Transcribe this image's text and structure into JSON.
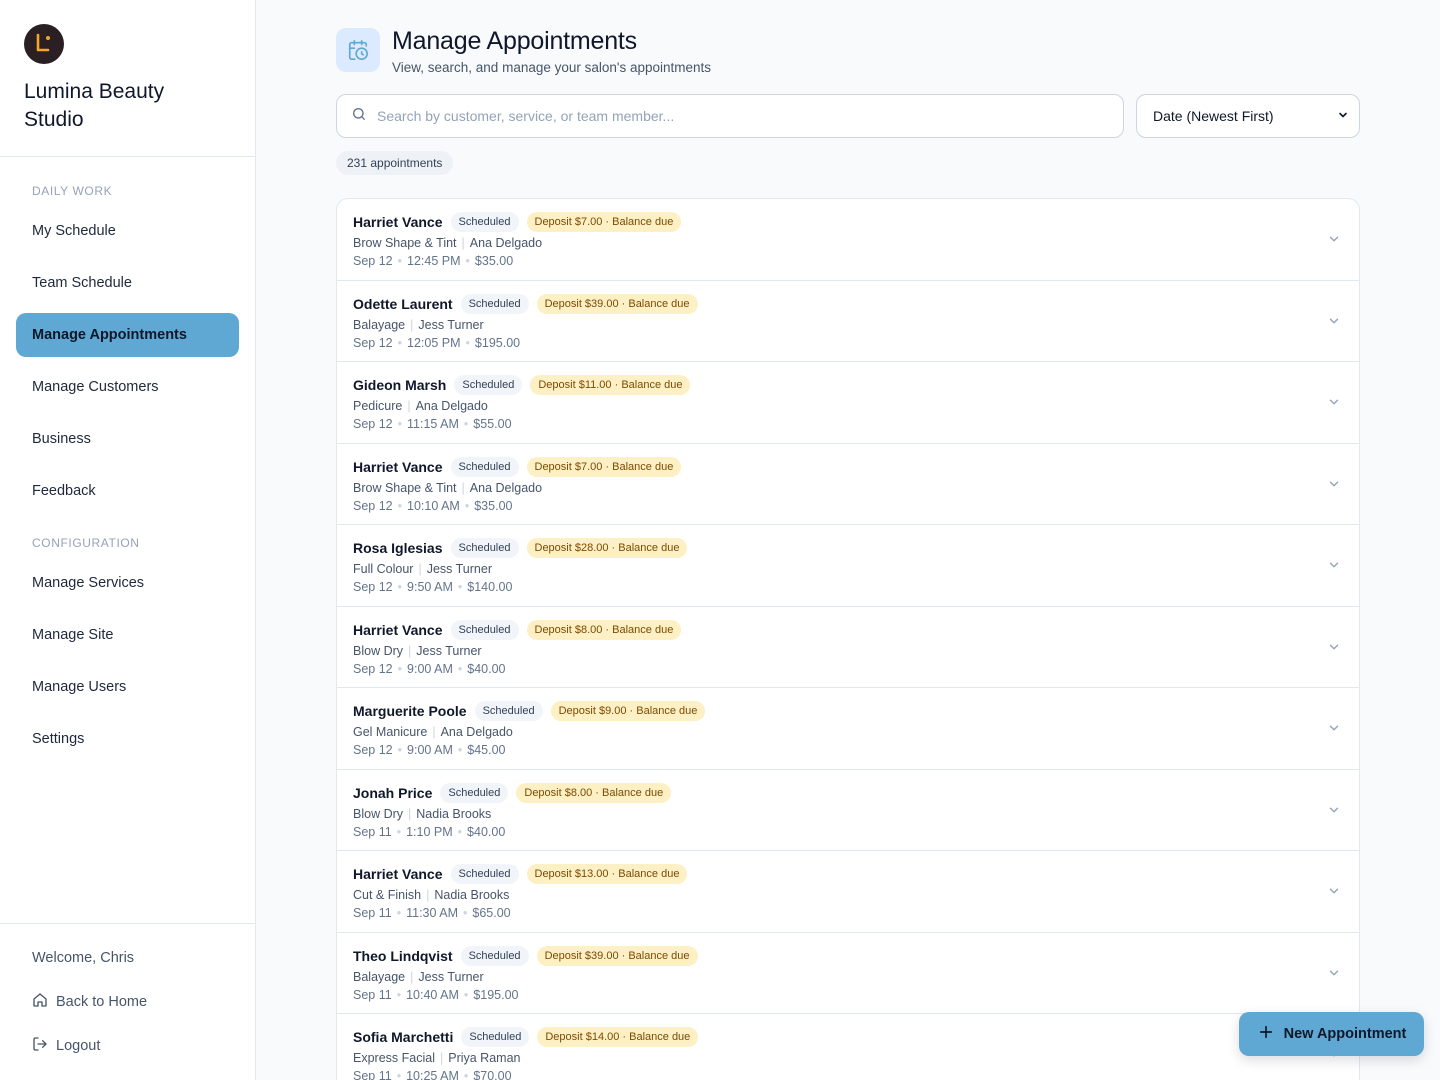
{
  "brand": {
    "name": "Lumina Beauty Studio",
    "logo_letter": "L"
  },
  "sidebar": {
    "sections": [
      {
        "label": "DAILY WORK",
        "items": [
          {
            "label": "My Schedule",
            "active": false
          },
          {
            "label": "Team Schedule",
            "active": false
          },
          {
            "label": "Manage Appointments",
            "active": true
          },
          {
            "label": "Manage Customers",
            "active": false
          },
          {
            "label": "Business",
            "active": false
          },
          {
            "label": "Feedback",
            "active": false
          }
        ]
      },
      {
        "label": "CONFIGURATION",
        "items": [
          {
            "label": "Manage Services",
            "active": false
          },
          {
            "label": "Manage Site",
            "active": false
          },
          {
            "label": "Manage Users",
            "active": false
          },
          {
            "label": "Settings",
            "active": false
          }
        ]
      }
    ],
    "welcome": "Welcome, Chris",
    "back_home": "Back to Home",
    "logout": "Logout"
  },
  "header": {
    "title": "Manage Appointments",
    "subtitle": "View, search, and manage your salon's appointments",
    "icon": "calendar-clock-icon"
  },
  "search": {
    "placeholder": "Search by customer, service, or team member...",
    "value": ""
  },
  "sort": {
    "selected": "Date (Newest First)"
  },
  "count_label": "231 appointments",
  "appointments": [
    {
      "customer": "Harriet Vance",
      "status": "Scheduled",
      "deposit": "Deposit $7.00 · Balance due",
      "service": "Brow Shape & Tint",
      "staff": "Ana Delgado",
      "date": "Sep 12",
      "time": "12:45 PM",
      "price": "$35.00"
    },
    {
      "customer": "Odette Laurent",
      "status": "Scheduled",
      "deposit": "Deposit $39.00 · Balance due",
      "service": "Balayage",
      "staff": "Jess Turner",
      "date": "Sep 12",
      "time": "12:05 PM",
      "price": "$195.00"
    },
    {
      "customer": "Gideon Marsh",
      "status": "Scheduled",
      "deposit": "Deposit $11.00 · Balance due",
      "service": "Pedicure",
      "staff": "Ana Delgado",
      "date": "Sep 12",
      "time": "11:15 AM",
      "price": "$55.00"
    },
    {
      "customer": "Harriet Vance",
      "status": "Scheduled",
      "deposit": "Deposit $7.00 · Balance due",
      "service": "Brow Shape & Tint",
      "staff": "Ana Delgado",
      "date": "Sep 12",
      "time": "10:10 AM",
      "price": "$35.00"
    },
    {
      "customer": "Rosa Iglesias",
      "status": "Scheduled",
      "deposit": "Deposit $28.00 · Balance due",
      "service": "Full Colour",
      "staff": "Jess Turner",
      "date": "Sep 12",
      "time": "9:50 AM",
      "price": "$140.00"
    },
    {
      "customer": "Harriet Vance",
      "status": "Scheduled",
      "deposit": "Deposit $8.00 · Balance due",
      "service": "Blow Dry",
      "staff": "Jess Turner",
      "date": "Sep 12",
      "time": "9:00 AM",
      "price": "$40.00"
    },
    {
      "customer": "Marguerite Poole",
      "status": "Scheduled",
      "deposit": "Deposit $9.00 · Balance due",
      "service": "Gel Manicure",
      "staff": "Ana Delgado",
      "date": "Sep 12",
      "time": "9:00 AM",
      "price": "$45.00"
    },
    {
      "customer": "Jonah Price",
      "status": "Scheduled",
      "deposit": "Deposit $8.00 · Balance due",
      "service": "Blow Dry",
      "staff": "Nadia Brooks",
      "date": "Sep 11",
      "time": "1:10 PM",
      "price": "$40.00"
    },
    {
      "customer": "Harriet Vance",
      "status": "Scheduled",
      "deposit": "Deposit $13.00 · Balance due",
      "service": "Cut & Finish",
      "staff": "Nadia Brooks",
      "date": "Sep 11",
      "time": "11:30 AM",
      "price": "$65.00"
    },
    {
      "customer": "Theo Lindqvist",
      "status": "Scheduled",
      "deposit": "Deposit $39.00 · Balance due",
      "service": "Balayage",
      "staff": "Jess Turner",
      "date": "Sep 11",
      "time": "10:40 AM",
      "price": "$195.00"
    },
    {
      "customer": "Sofia Marchetti",
      "status": "Scheduled",
      "deposit": "Deposit $14.00 · Balance due",
      "service": "Express Facial",
      "staff": "Priya Raman",
      "date": "Sep 11",
      "time": "10:25 AM",
      "price": "$70.00"
    }
  ],
  "fab": {
    "label": "New Appointment"
  },
  "colors": {
    "accent": "#5fa8d3",
    "deposit_bg": "#fdf0c4",
    "logo_bg": "#2a1f22",
    "logo_accent": "#f5a623"
  }
}
